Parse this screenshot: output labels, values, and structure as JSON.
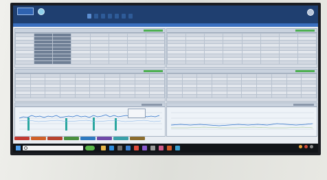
{
  "header": {
    "app_name": "",
    "org_name": "",
    "menu": [
      "",
      "",
      "",
      "",
      "",
      "",
      ""
    ],
    "user_text": ""
  },
  "panels": {
    "top_left_title": "",
    "top_right_title": "",
    "mid_left_title": "",
    "mid_right_title": "",
    "chart_left_title": "",
    "chart_right_title": ""
  },
  "colors": {
    "header_bg": "#1f3f70",
    "accent_blue": "#3a6fbf",
    "status_green": "#4caf50",
    "series_line": "#2a6fc9",
    "bar_teal": "#2aa7a0",
    "taskbar_bg": "#111418"
  },
  "buttons": [
    {
      "color": "#c23a32"
    },
    {
      "color": "#d0612a"
    },
    {
      "color": "#b7442f"
    },
    {
      "color": "#4a8f3f"
    },
    {
      "color": "#2e7ac0"
    },
    {
      "color": "#6f4aa8"
    },
    {
      "color": "#3aa0a8"
    },
    {
      "color": "#8b6d2f"
    }
  ],
  "taskbar": {
    "search_placeholder": "",
    "clock_time": "",
    "clock_date": "",
    "task_icons": [
      "file-explorer-icon",
      "edge-icon",
      "store-icon",
      "mail-icon",
      "chrome-icon",
      "app-icon",
      "settings-icon",
      "media-icon",
      "office-icon",
      "photos-icon"
    ]
  }
}
